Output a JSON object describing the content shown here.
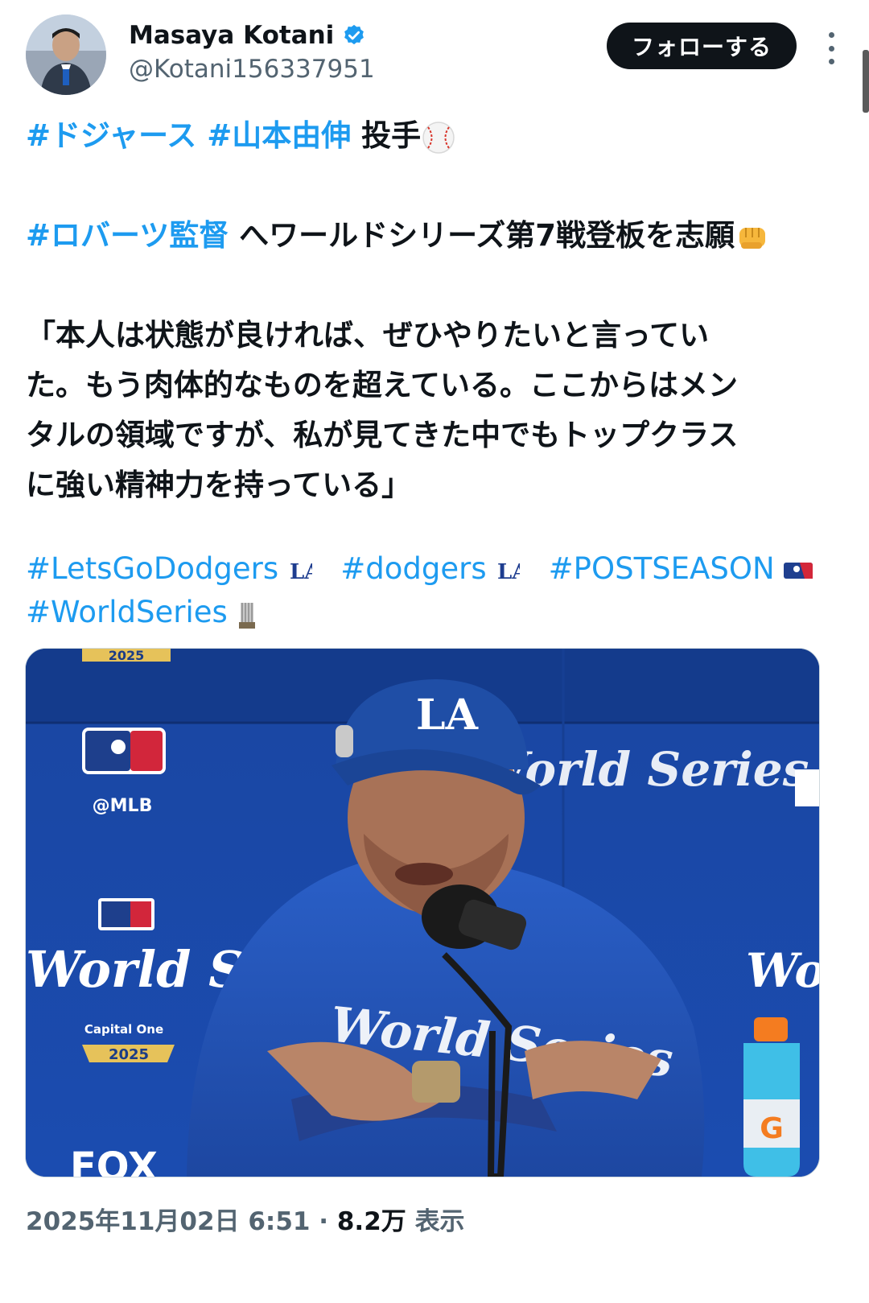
{
  "author": {
    "display_name": "Masaya Kotani",
    "handle": "@Kotani156337951",
    "verified": true
  },
  "actions": {
    "follow_label": "フォローする"
  },
  "tweet": {
    "line1": {
      "tag1": "#ドジャース",
      "tag2": "#山本由伸",
      "text": "投手"
    },
    "line2": {
      "tag": "#ロバーツ監督",
      "text": "へワールドシリーズ第7戦登板を志願"
    },
    "quote": [
      "「本人は状態が良ければ、ぜひやりたいと言ってい",
      "た。もう肉体的なものを超えている。ここからはメン",
      "タルの領域ですが、私が見てきた中でもトップクラス",
      "に強い精神力を持っている」"
    ],
    "hashtags_row1": [
      "#LetsGoDodgers",
      "#dodgers",
      "#POSTSEASON"
    ],
    "hashtags_row2": [
      "#WorldSeries"
    ]
  },
  "photo": {
    "cap_logo": "LA",
    "board_handle": "@MLB",
    "board_brand": "World Series",
    "board_sponsor": "Capital One",
    "board_year": "2025",
    "board_year_top": "2025",
    "board_network": "FOX",
    "hoodie_text": "World Series",
    "bottle_letter": "G"
  },
  "meta": {
    "timestamp": "2025年11月02日 6:51",
    "separator": "·",
    "views": "8.2万",
    "views_label": "表示"
  },
  "colors": {
    "link": "#1d9bf0",
    "verified": "#1d9bf0",
    "follow_bg": "#0f1419",
    "backdrop": "#1c4fb4"
  }
}
